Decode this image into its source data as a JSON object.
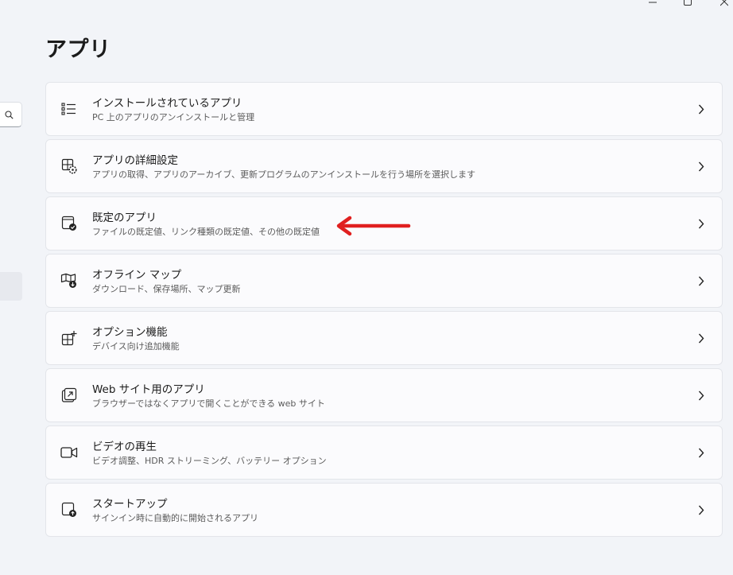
{
  "page": {
    "title": "アプリ"
  },
  "window_controls": [
    "minimize-icon",
    "maximize-icon",
    "close-icon"
  ],
  "sidebar": {
    "search_icon": "search-icon"
  },
  "items": [
    {
      "title": "インストールされているアプリ",
      "desc": "PC 上のアプリのアンインストールと管理",
      "icon": "installed-apps-list-icon"
    },
    {
      "title": "アプリの詳細設定",
      "desc": "アプリの取得、アプリのアーカイブ、更新プログラムのアンインストールを行う場所を選択します",
      "icon": "advanced-app-settings-icon"
    },
    {
      "title": "既定のアプリ",
      "desc": "ファイルの既定値、リンク種類の既定値、その他の既定値",
      "icon": "default-apps-icon"
    },
    {
      "title": "オフライン マップ",
      "desc": "ダウンロード、保存場所、マップ更新",
      "icon": "offline-maps-icon"
    },
    {
      "title": "オプション機能",
      "desc": "デバイス向け追加機能",
      "icon": "optional-features-icon"
    },
    {
      "title": "Web サイト用のアプリ",
      "desc": "ブラウザーではなくアプリで開くことができる web サイト",
      "icon": "apps-for-websites-icon"
    },
    {
      "title": "ビデオの再生",
      "desc": "ビデオ調整、HDR ストリーミング、バッテリー オプション",
      "icon": "video-playback-icon"
    },
    {
      "title": "スタートアップ",
      "desc": "サインイン時に自動的に開始されるアプリ",
      "icon": "startup-icon"
    }
  ],
  "annotation": {
    "type": "red-arrow",
    "color": "#e02020",
    "points_to": "既定のアプリ"
  },
  "colors": {
    "background": "#f2f4f8",
    "card": "#fbfbfd",
    "card_border": "#e3e5ea",
    "arrow": "#e02020"
  }
}
